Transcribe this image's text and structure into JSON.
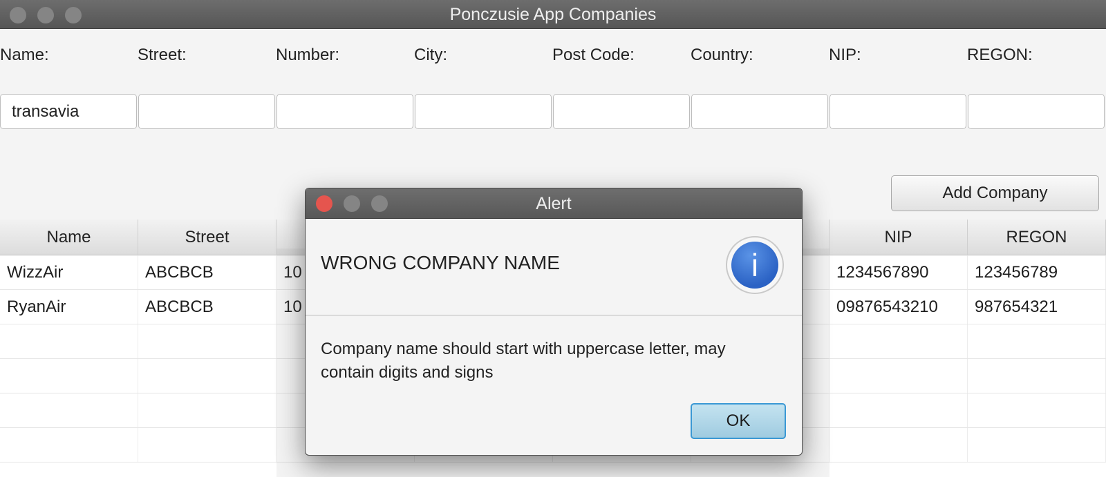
{
  "window": {
    "title": "Ponczusie App Companies"
  },
  "form": {
    "labels": [
      "Name:",
      "Street:",
      "Number:",
      "City:",
      "Post Code:",
      "Country:",
      "NIP:",
      "REGON:"
    ],
    "values": [
      "transavia",
      "",
      "",
      "",
      "",
      "",
      "",
      ""
    ],
    "add_button": "Add Company"
  },
  "table": {
    "columns": [
      "Name",
      "Street",
      "",
      "",
      "",
      "",
      "NIP",
      "REGON"
    ],
    "rows": [
      [
        "WizzAir",
        "ABCBCB",
        "10",
        "",
        "",
        "",
        "1234567890",
        "123456789"
      ],
      [
        "RyanAir",
        "ABCBCB",
        "10",
        "",
        "",
        "",
        "09876543210",
        "987654321"
      ]
    ]
  },
  "dialog": {
    "title": "Alert",
    "heading": "WRONG COMPANY NAME",
    "info_icon": "i",
    "content": "Company name should start with uppercase letter, may contain digits and signs",
    "ok_button": "OK"
  }
}
